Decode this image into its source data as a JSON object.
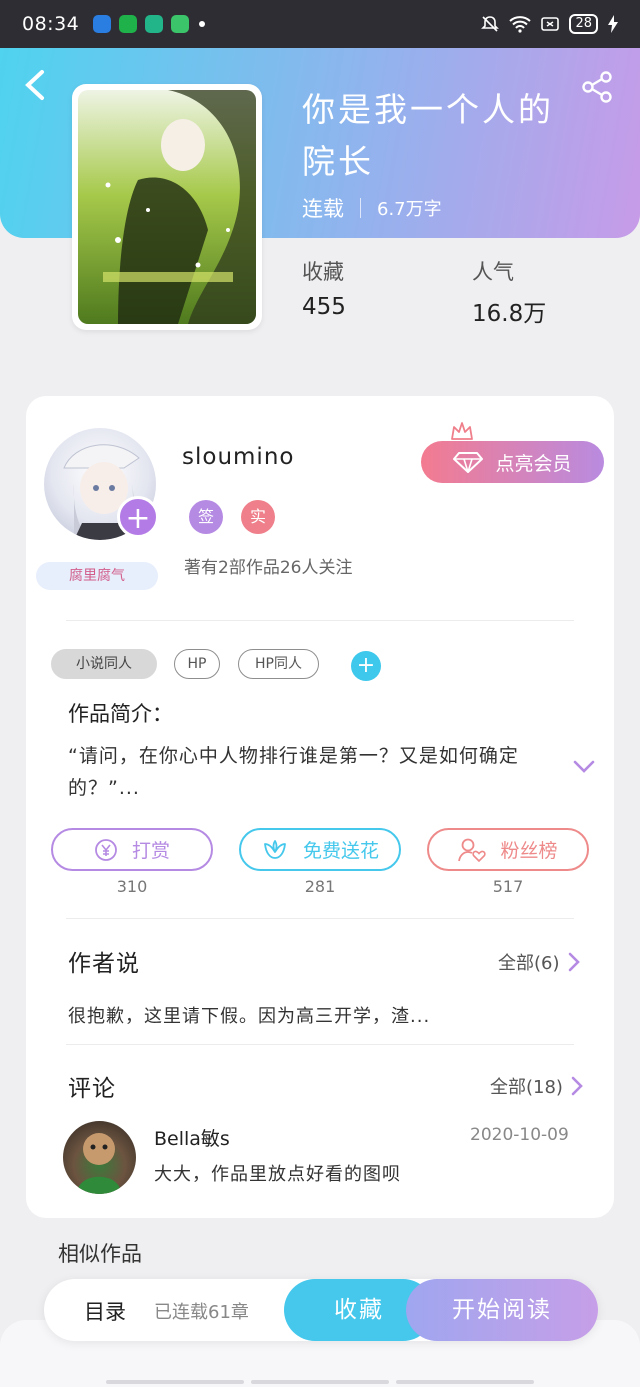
{
  "status_bar": {
    "time": "08:34",
    "battery": "28"
  },
  "book": {
    "title_line1": "你是我一个人的",
    "title_line2": "院长",
    "status": "连载",
    "words": "6.7万字",
    "stats": [
      {
        "label": "收藏",
        "value": "455"
      },
      {
        "label": "人气",
        "value": "16.8万"
      }
    ]
  },
  "author": {
    "name": "sloumino",
    "badges": [
      "签",
      "实"
    ],
    "subtitle": "著有2部作品26人关注",
    "avatar_tag": "腐里腐气",
    "vip_label": "点亮会员"
  },
  "tags": [
    "小说同人",
    "HP",
    "HP同人"
  ],
  "intro": {
    "title": "作品简介：",
    "text": "“请问，在你心中人物排行谁是第一？又是如何确定的？”..."
  },
  "actions": [
    {
      "label": "打赏",
      "count": "310",
      "color": "#b58ae3"
    },
    {
      "label": "免费送花",
      "count": "281",
      "color": "#45c8ec"
    },
    {
      "label": "粉丝榜",
      "count": "517",
      "color": "#ee8a8a"
    }
  ],
  "author_says": {
    "title": "作者说",
    "more": "全部(6)",
    "text": "很抱歉，这里请下假。因为高三开学，渣..."
  },
  "comments": {
    "title": "评论",
    "more": "全部(18)",
    "items": [
      {
        "user": "Bella敏s",
        "date": "2020-10-09",
        "text": "大大，作品里放点好看的图呗"
      }
    ]
  },
  "similar_title": "相似作品",
  "bottom_bar": {
    "toc": "目录",
    "chapters": "已连载61章",
    "favorite": "收藏",
    "read": "开始阅读"
  },
  "colors": {
    "accent_blue": "#45c8ec",
    "accent_purple": "#b37be6",
    "accent_pink": "#ee8a8a"
  }
}
